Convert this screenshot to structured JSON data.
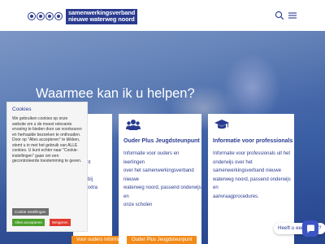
{
  "header": {
    "logo_line1": "samenwerkingsverband",
    "logo_line2": "nieuwe waterweg noord",
    "search_icon": "search-icon",
    "menu_icon": "hamburger-menu-icon"
  },
  "hero": {
    "title": "Waarmee kan ik u helpen?"
  },
  "cards": [
    {
      "title": "",
      "text_lines": [
        "IWN",
        "vorigent",
        "dam,",
        "vaand bij",
        "m het extra"
      ],
      "button_label": "Voor ouders Informatie"
    },
    {
      "icon": "users-group-icon",
      "title": "Ouder Plus Jeugdsteunpunt",
      "text_lines": [
        "Informatie voor ouders en leerlingen",
        "over het samenwerkingsverband nieuwe",
        "waterweg noord, passend onderwijs en",
        "onze scholen"
      ],
      "button_label": "Ouder Plus Jeugdsteunpunt"
    },
    {
      "icon": "graduation-cap-icon",
      "title": "Informatie voor professionals",
      "text_lines": [
        "Informatie voor professionals uit het",
        "onderwijs over het",
        "samenwerkingsverband nieuwe",
        "waterweg noord, passend onderwijs en",
        "aanvraagprocedures."
      ],
      "button_label": "Informatie voor professionals"
    }
  ],
  "cookie": {
    "title": "Cookies",
    "text": "We gebruiken cookies op onze website om u de meest relevante ervaring te bieden door uw voorkeuren en herhaalde bezoeken te onthouden. Door op \"Alles accepteren\" te klikken, stemt u in met het gebruik van ALLE cookies. U kunt echter naar \"Cookie-instellingen\" gaan om een gecontroleerde toestemming te geven.",
    "settings_label": "Cookie instellingen",
    "accept_label": "Alles accepteren",
    "refuse_label": "Weigeren"
  },
  "help": {
    "label": "Heeft u een vraag?",
    "icon": "chat-icon"
  },
  "colors": {
    "brand_blue": "#2a3b8f",
    "orange": "#f28b1a",
    "accept_green": "#4ca02c",
    "refuse_red": "#e03b2e",
    "chat_blue": "#3d55c4"
  }
}
